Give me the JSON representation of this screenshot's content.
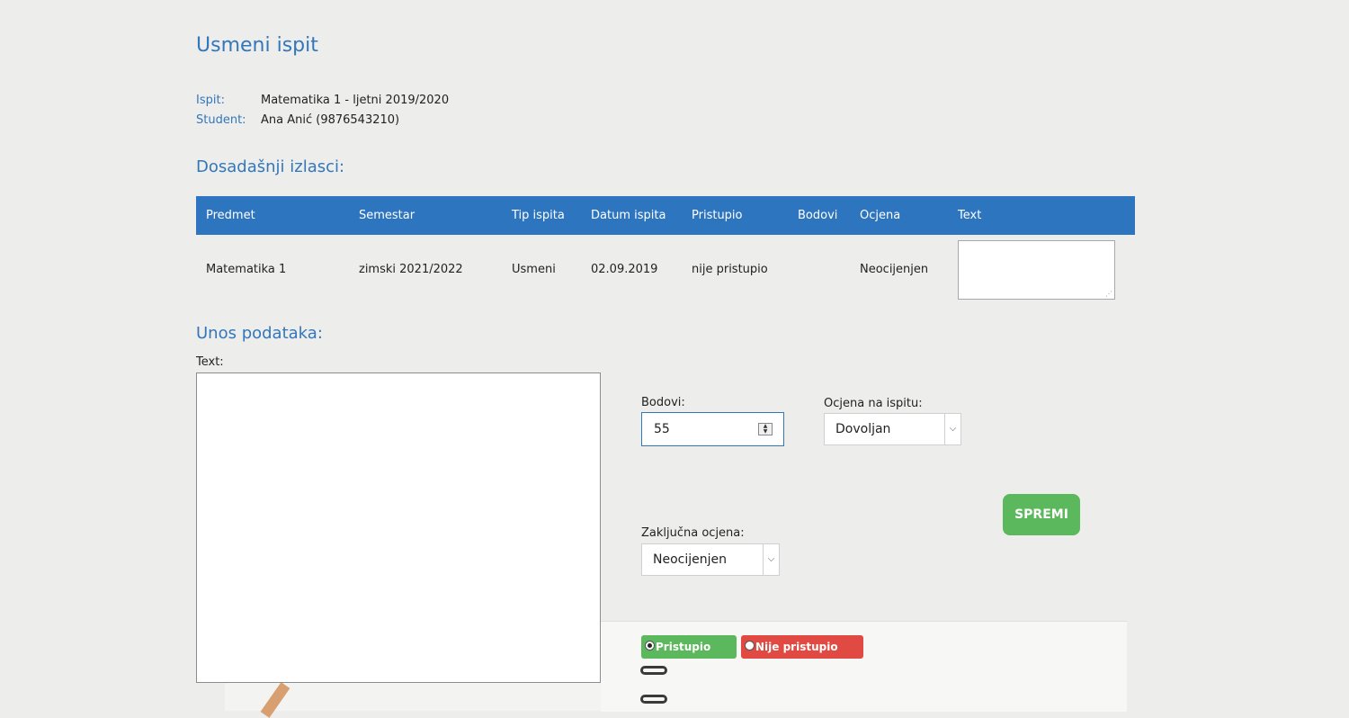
{
  "page": {
    "title": "Usmeni ispit"
  },
  "info": {
    "exam_label": "Ispit:",
    "exam_value": "Matematika 1 - ljetni 2019/2020",
    "student_label": "Student:",
    "student_value": "Ana Anić (9876543210)"
  },
  "history": {
    "title": "Dosadašnji izlasci:",
    "columns": [
      "Predmet",
      "Semestar",
      "Tip ispita",
      "Datum ispita",
      "Pristupio",
      "Bodovi",
      "Ocjena",
      "Text"
    ],
    "rows": [
      [
        "Matematika 1",
        "zimski 2021/2022",
        "Usmeni",
        "02.09.2019",
        "nije pristupio",
        "",
        "Neocijenjen",
        ""
      ]
    ]
  },
  "form": {
    "title": "Unos podataka:",
    "text_label": "Text:",
    "points_label": "Bodovi:",
    "points_value": "55",
    "grade_label": "Ocjena na ispitu:",
    "grade_value": "Dovoljan",
    "final_grade_label": "Zaključna ocjena:",
    "final_grade_value": "Neocijenjen",
    "save_label": "SPREMI",
    "attended_label": "Pristupio",
    "not_attended_label": "Nije pristupio",
    "attended_selected": true
  },
  "colors": {
    "accent": "#3377bb",
    "header": "#2e75bf",
    "success": "#5cb85c",
    "danger": "#e04a42"
  },
  "icons": {
    "spinner": "spinner-arrows-icon",
    "dropdown": "chevron-down-icon",
    "resize": "resize-grip-icon"
  }
}
